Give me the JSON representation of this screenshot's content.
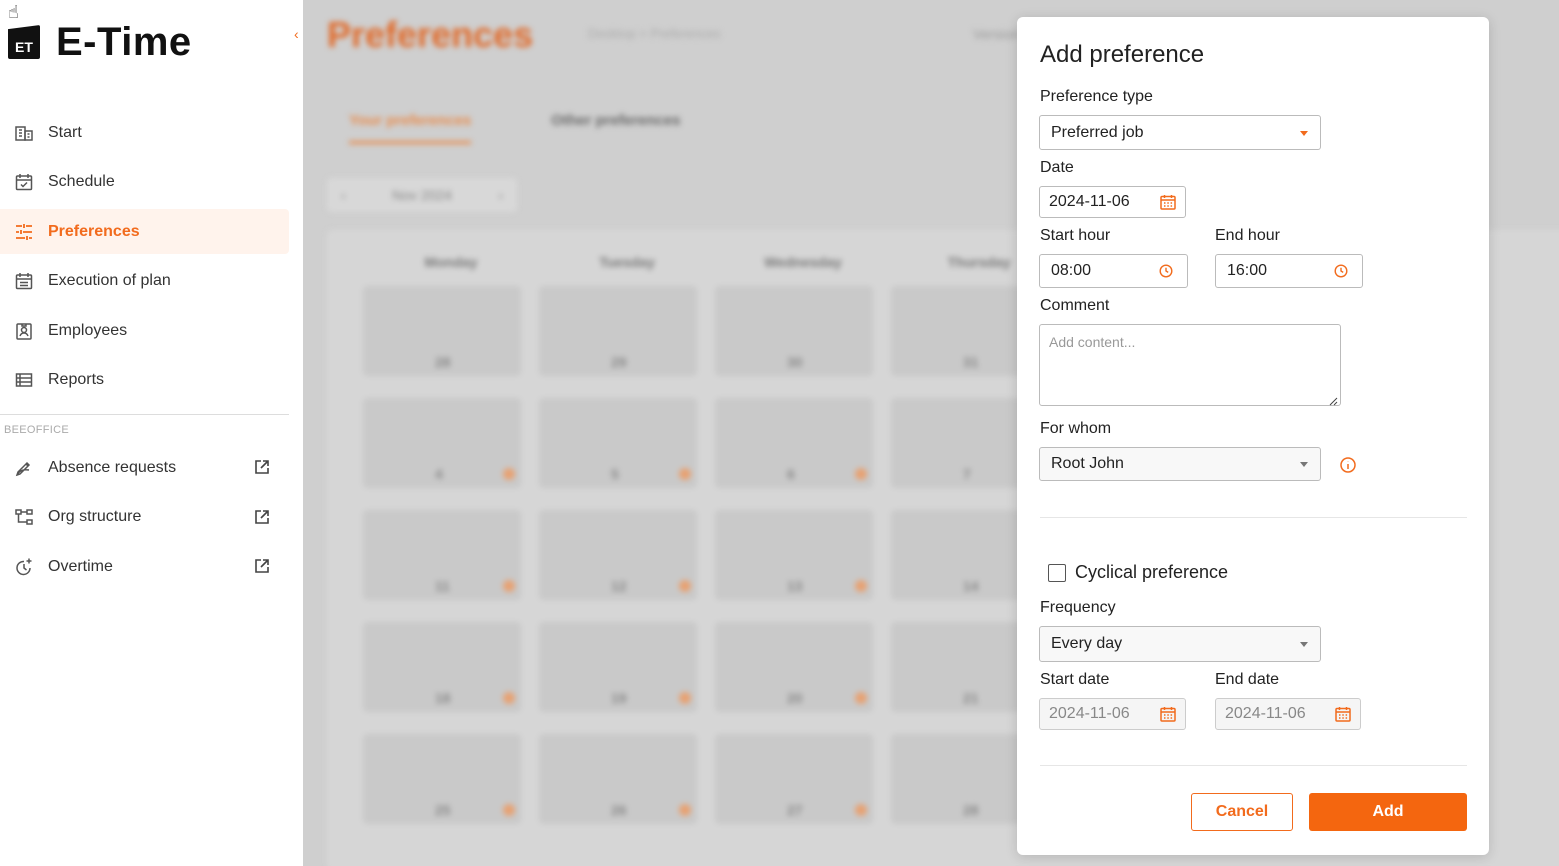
{
  "app": {
    "logo_mark": "ET",
    "name": "E-Time"
  },
  "sidebar": {
    "items": [
      {
        "label": "Start",
        "icon": "building-icon"
      },
      {
        "label": "Schedule",
        "icon": "calendar-check-icon"
      },
      {
        "label": "Preferences",
        "icon": "sliders-icon",
        "active": true
      },
      {
        "label": "Execution of plan",
        "icon": "calendar-list-icon"
      },
      {
        "label": "Employees",
        "icon": "badge-icon"
      },
      {
        "label": "Reports",
        "icon": "list-icon"
      }
    ],
    "section_label": "BEEOFFICE",
    "external_items": [
      {
        "label": "Absence requests",
        "icon": "pen-icon"
      },
      {
        "label": "Org structure",
        "icon": "org-tree-icon"
      },
      {
        "label": "Overtime",
        "icon": "clock-plus-icon"
      }
    ]
  },
  "background": {
    "title": "Preferences",
    "breadcrumb": "Desktop  >  Preferences",
    "version": "Version",
    "tabs": [
      "Your preferences",
      "Other preferences"
    ],
    "month": "Nov 2024",
    "weekdays": [
      "Monday",
      "Tuesday",
      "Wednesday",
      "Thursday"
    ],
    "weeks": [
      [
        "28",
        "29",
        "30",
        "31"
      ],
      [
        "4",
        "5",
        "6",
        "7"
      ],
      [
        "11",
        "12",
        "13",
        "14"
      ],
      [
        "18",
        "19",
        "20",
        "21"
      ],
      [
        "25",
        "26",
        "27",
        "28"
      ]
    ]
  },
  "dialog": {
    "title": "Add preference",
    "preference_type_label": "Preference type",
    "preference_type_value": "Preferred job",
    "date_label": "Date",
    "date_value": "2024-11-06",
    "start_hour_label": "Start hour",
    "start_hour_value": "08:00",
    "end_hour_label": "End hour",
    "end_hour_value": "16:00",
    "comment_label": "Comment",
    "comment_placeholder": "Add content...",
    "for_whom_label": "For whom",
    "for_whom_value": "Root John",
    "cyclical_label": "Cyclical preference",
    "cyclical_checked": false,
    "frequency_label": "Frequency",
    "frequency_value": "Every day",
    "start_date_label": "Start date",
    "start_date_value": "2024-11-06",
    "end_date_label": "End date",
    "end_date_value": "2024-11-06",
    "cancel_label": "Cancel",
    "add_label": "Add"
  },
  "colors": {
    "accent": "#f26b1d",
    "active_bg": "#fff3ec"
  }
}
